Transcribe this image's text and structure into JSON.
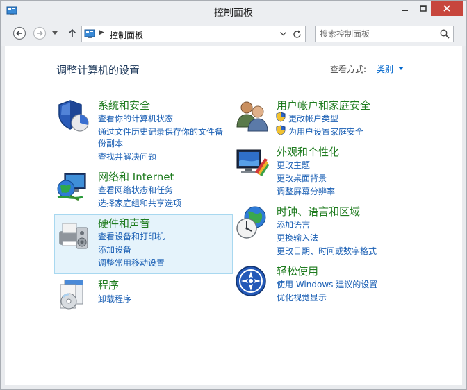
{
  "window": {
    "title": "控制面板",
    "accent": "#c7463d"
  },
  "nav": {
    "address": "控制面板",
    "search_placeholder": "搜索控制面板",
    "icons": [
      "back-arrow-icon",
      "forward-arrow-icon",
      "chevron-down-icon",
      "up-arrow-icon",
      "refresh-icon",
      "search-icon"
    ]
  },
  "header": {
    "title": "调整计算机的设置",
    "view_label": "查看方式:",
    "view_value": "类别"
  },
  "categories": {
    "system": {
      "title": "系统和安全",
      "icon": "shield-pie-icon",
      "links": [
        "查看你的计算机状态",
        "通过文件历史记录保存你的文件备",
        "份副本",
        "查找并解决问题"
      ]
    },
    "network": {
      "title": "网络和 Internet",
      "icon": "network-globe-icon",
      "links": [
        "查看网络状态和任务",
        "选择家庭组和共享选项"
      ]
    },
    "hardware": {
      "title": "硬件和声音",
      "icon": "printer-speaker-icon",
      "links": [
        "查看设备和打印机",
        "添加设备",
        "调整常用移动设置"
      ]
    },
    "programs": {
      "title": "程序",
      "icon": "programs-disc-icon",
      "links": [
        "卸载程序"
      ]
    },
    "users": {
      "title": "用户帐户和家庭安全",
      "icon": "users-icon",
      "links": [
        "更改帐户类型",
        "为用户设置家庭安全"
      ]
    },
    "appearance": {
      "title": "外观和个性化",
      "icon": "monitor-palette-icon",
      "links": [
        "更改主题",
        "更改桌面背景",
        "调整屏幕分辨率"
      ]
    },
    "clock": {
      "title": "时钟、语言和区域",
      "icon": "clock-globe-icon",
      "links": [
        "添加语言",
        "更换输入法",
        "更改日期、时间或数字格式"
      ]
    },
    "ease": {
      "title": "轻松使用",
      "icon": "ease-of-access-icon",
      "links": [
        "使用 Windows 建议的设置",
        "优化视觉显示"
      ]
    }
  },
  "colors": {
    "category_title": "#1e7b1e",
    "link": "#1a5fb4",
    "page_title": "#1e395b",
    "hover_bg": "#e5f3fb"
  }
}
